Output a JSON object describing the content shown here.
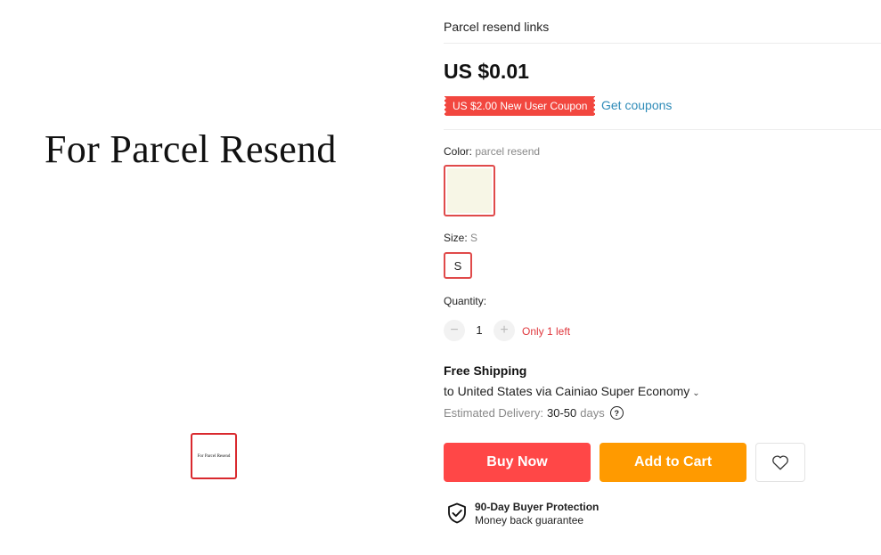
{
  "product": {
    "title": "Parcel resend links",
    "image_text": "For Parcel Resend",
    "thumbnail_text": "For Parcel Resend"
  },
  "price": {
    "amount": "US $0.01",
    "coupon_label": "US $2.00 New User Coupon",
    "get_coupons": "Get coupons"
  },
  "color": {
    "label": "Color:",
    "value": "parcel resend",
    "swatch_color": "#f7f6e6"
  },
  "size": {
    "label": "Size:",
    "value": "S",
    "option": "S"
  },
  "quantity": {
    "label": "Quantity:",
    "minus": "−",
    "value": "1",
    "plus": "+",
    "stock_note": "Only 1 left"
  },
  "shipping": {
    "title": "Free Shipping",
    "method": "to United States via Cainiao Super Economy",
    "delivery_label": "Estimated Delivery:",
    "delivery_range": "30-50",
    "delivery_unit": "days",
    "help_icon": "question-circle-icon"
  },
  "actions": {
    "buy_now": "Buy Now",
    "add_to_cart": "Add to Cart",
    "wishlist_icon": "heart-icon"
  },
  "protection": {
    "title": "90-Day Buyer Protection",
    "subtitle": "Money back guarantee",
    "icon": "shield-check-icon"
  },
  "colors": {
    "accent_red": "#ff4747",
    "accent_orange": "#ff9a00",
    "link_blue": "#2e8bb8",
    "coupon_red": "#f2473f"
  }
}
